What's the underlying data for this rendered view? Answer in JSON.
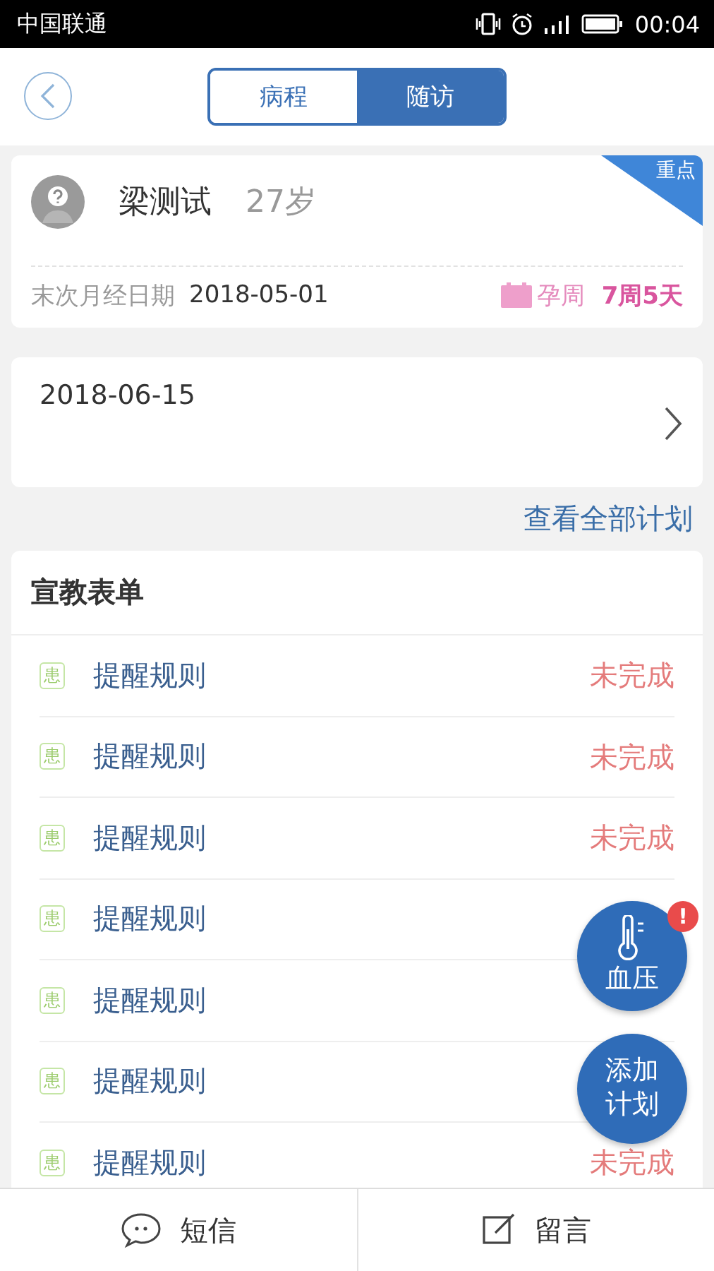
{
  "status_bar": {
    "carrier": "中国联通",
    "time": "00:04"
  },
  "tabs": [
    {
      "label": "病程",
      "selected": false
    },
    {
      "label": "随访",
      "selected": true
    }
  ],
  "patient": {
    "name": "梁测试",
    "age": "27岁",
    "tag": "重点",
    "lmp_label": "末次月经日期",
    "lmp_date": "2018-05-01",
    "gest_label": "孕周",
    "gest_value": "7周5天"
  },
  "plan": {
    "date": "2018-06-15"
  },
  "view_all": "查看全部计划",
  "forms": {
    "title": "宣教表单",
    "items": [
      {
        "badge": "患",
        "title": "提醒规则",
        "status": "未完成"
      },
      {
        "badge": "患",
        "title": "提醒规则",
        "status": "未完成"
      },
      {
        "badge": "患",
        "title": "提醒规则",
        "status": "未完成"
      },
      {
        "badge": "患",
        "title": "提醒规则"
      },
      {
        "badge": "患",
        "title": "提醒规则"
      },
      {
        "badge": "患",
        "title": "提醒规则"
      },
      {
        "badge": "患",
        "title": "提醒规则",
        "status": "未完成"
      }
    ]
  },
  "fabs": [
    {
      "kind": "thermometer",
      "label": "血压",
      "alert": "!"
    },
    {
      "kind": "text",
      "label": "添加计划"
    }
  ],
  "bottom_tabs": [
    {
      "kind": "chat",
      "label": "短信"
    },
    {
      "kind": "edit",
      "label": "留言"
    }
  ]
}
